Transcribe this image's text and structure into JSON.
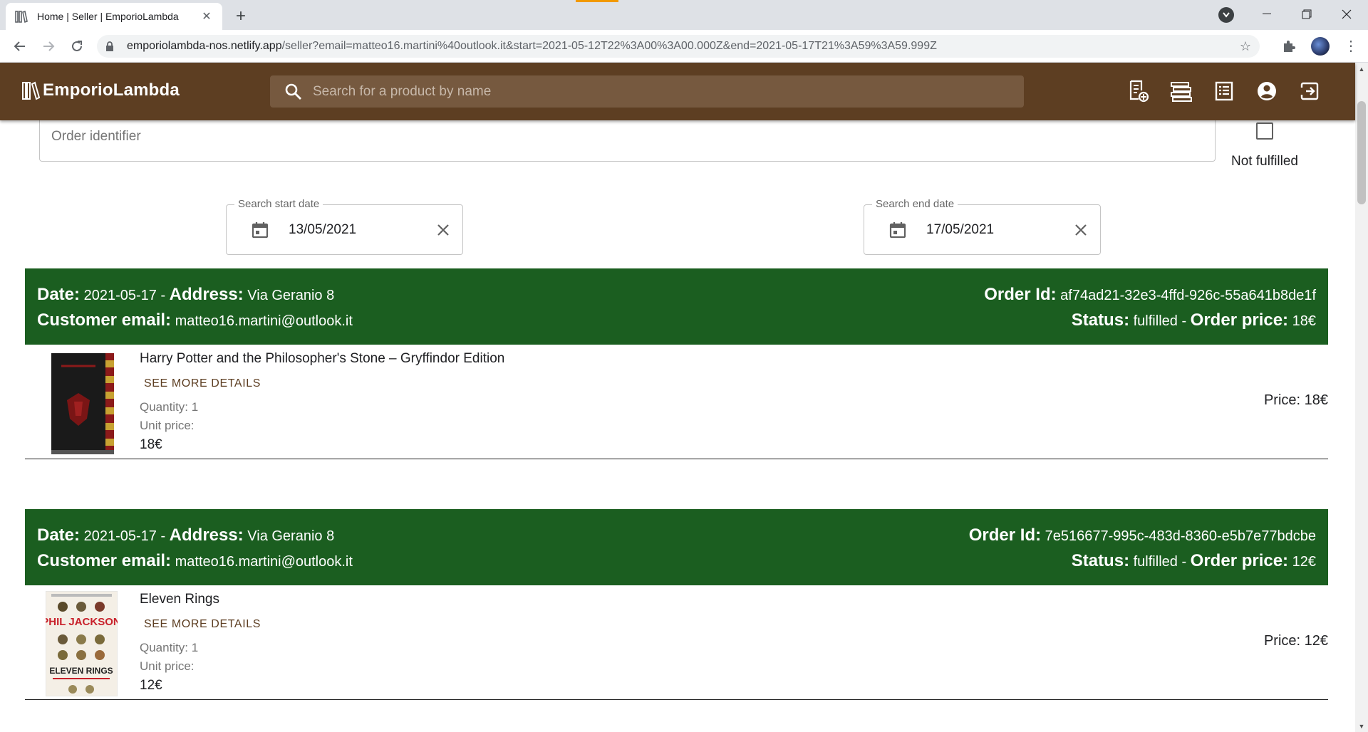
{
  "browser": {
    "tab_title": "Home | Seller | EmporioLambda",
    "url_host": "emporiolambda-nos.netlify.app",
    "url_path": "/seller?email=matteo16.martini%40outlook.it&start=2021-05-12T22%3A00%3A00.000Z&end=2021-05-17T21%3A59%3A59.999Z",
    "new_tab_symbol": "+",
    "close_symbol": "✕",
    "icons": [
      "bookshelf-favicon",
      "back-icon",
      "forward-icon",
      "reload-icon",
      "lock-icon",
      "star-icon",
      "extensions-icon",
      "profile-avatar",
      "menu-icon",
      "minimize-icon",
      "maximize-icon",
      "close-icon"
    ]
  },
  "header": {
    "brand": "EmporioLambda",
    "search_placeholder": "Search for a product by name",
    "icons": [
      "add-product-icon",
      "catalog-icon",
      "orders-icon",
      "account-icon",
      "logout-icon"
    ],
    "background_color": "#5d3e22"
  },
  "filters": {
    "order_id_placeholder": "Order identifier",
    "not_fulfilled_label": "Not fulfilled",
    "start_date_label": "Search start date",
    "start_date_value": "13/05/2021",
    "end_date_label": "Search end date",
    "end_date_value": "17/05/2021"
  },
  "labels": {
    "date": "Date:",
    "address": "Address:",
    "customer_email": "Customer email:",
    "order_id": "Order Id:",
    "status": "Status:",
    "order_price": "Order price:",
    "separator": " - ",
    "see_more": "SEE MORE DETAILS",
    "unit_price": "Unit price:"
  },
  "colors": {
    "order_header": "#1b5e20",
    "accent": "#5d3e22"
  },
  "orders": [
    {
      "date": "2021-05-17",
      "address": "Via Geranio 8",
      "customer_email": "matteo16.martini@outlook.it",
      "order_id": "af74ad21-32e3-4ffd-926c-55a641b8de1f",
      "status": "fulfilled",
      "order_price": "18€",
      "item": {
        "title": "Harry Potter and the Philosopher's Stone – Gryffindor Edition",
        "quantity": "Quantity: 1",
        "unit_price": "18€",
        "price": "Price: 18€",
        "cover": "harry-potter-gryffindor-cover"
      }
    },
    {
      "date": "2021-05-17",
      "address": "Via Geranio 8",
      "customer_email": "matteo16.martini@outlook.it",
      "order_id": "7e516677-995c-483d-8360-e5b7e77bdcbe",
      "status": "fulfilled",
      "order_price": "12€",
      "item": {
        "title": "Eleven Rings",
        "quantity": "Quantity: 1",
        "unit_price": "12€",
        "price": "Price: 12€",
        "cover": "eleven-rings-cover",
        "cover_text_top": "PHIL JACKSON",
        "cover_text_bottom": "ELEVEN RINGS"
      }
    }
  ]
}
